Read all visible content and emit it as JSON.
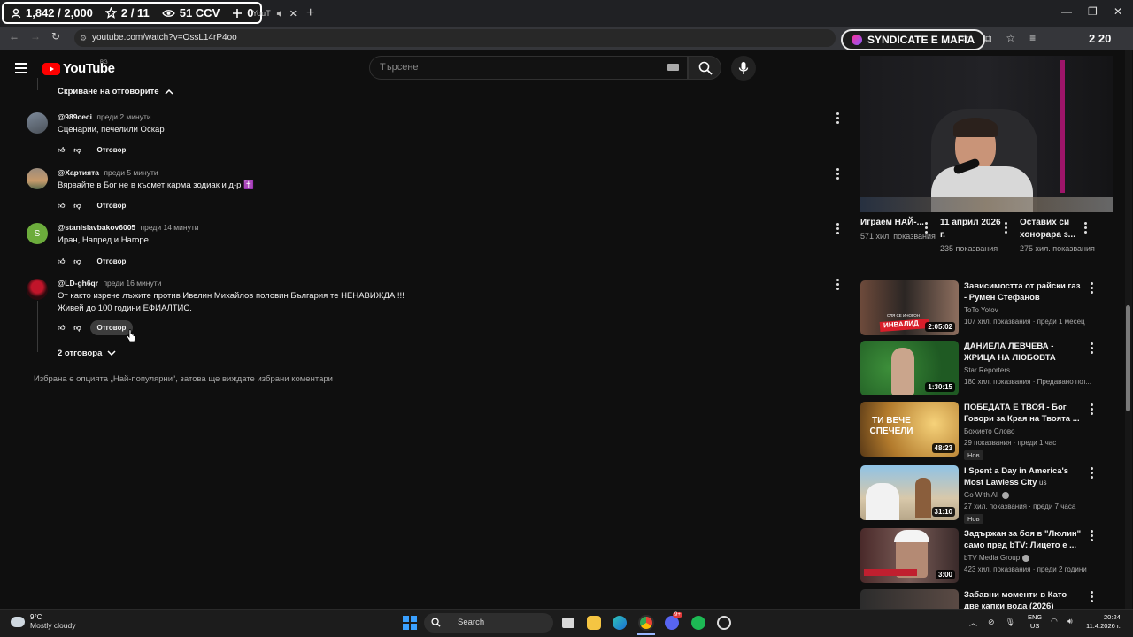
{
  "overlay": {
    "viewers": "1,842 / 2,000",
    "stars": "2 / 11",
    "watch": "51 CCV",
    "plus": "0"
  },
  "browser": {
    "tab_title": "YouT",
    "url": "youtube.com/watch?v=OssL14rP4oo",
    "extension_label": "SYNDICATE E MAFIA",
    "extension_counter": "2 20"
  },
  "youtube": {
    "logo_text": "YouTube",
    "region": "BG",
    "search_placeholder": "Търсене"
  },
  "comments": {
    "hide_replies": "Скриване на отговорите",
    "reply_label": "Отговор",
    "items": [
      {
        "author": "@989ceci",
        "time": "преди 2 минути",
        "text": "Сценарии, печелили Оскар"
      },
      {
        "author": "@Хартията",
        "time": "преди 5 минути",
        "text": "Вярвайте в Бог не в късмет карма зодиак и д-р ✝️"
      },
      {
        "author": "@stanislavbakov6005",
        "time": "преди 14 минути",
        "text": "Иран, Напред и Нагоре."
      },
      {
        "author": "@LD-gh6qr",
        "time": "преди 16 минути",
        "text_line1": "От както изрече лъжите против Ивелин Михайлов половин България те НЕНАВИЖДА !!!",
        "text_line2": "Живей до 100 години ЕФИАЛТИС."
      }
    ],
    "replies_toggle": "2 отговора",
    "sort_note": "Избрана е опцията „Най-популярни“, затова ще виждате избрани коментари",
    "avatar_letter": "S"
  },
  "shorts": [
    {
      "title": "Играем НАЙ-...",
      "views": "571 хил. показвания"
    },
    {
      "title": "11 април 2026 г.",
      "views": "235 показвания"
    },
    {
      "title": "Оставих си хонорара з...",
      "views": "275 хил. показвания"
    }
  ],
  "recommendations": [
    {
      "title": "Зависимостта от райски газ - Румен Стефанов",
      "channel": "ToTo Yotov",
      "meta": "107 хил. показвания · преди 1 месец",
      "duration": "2:05:02",
      "badge": "",
      "thumb_overlay": "ИНВАЛИД",
      "thumb_small_text": "СЛЯ СЕ ИНОГОН",
      "verified": false
    },
    {
      "title": "ДАНИЕЛА ЛЕВЧЕВА - ЖРИЦА НА ЛЮБОВТА",
      "channel": "Star Reporters",
      "meta": "180 хил. показвания · Предавано пот...",
      "duration": "1:30:15",
      "badge": "",
      "thumb_overlay": "",
      "thumb_small_text": "",
      "verified": false
    },
    {
      "title": "ПОБЕДАТА Е ТВОЯ - Бог Говори за Края на Твоята ...",
      "channel": "Божието Слово",
      "meta": "29 показвания · преди 1 час",
      "duration": "48:23",
      "badge": "Нов",
      "thumb_overlay": "ТИ ВЕЧЕ СПЕЧЕЛИ",
      "thumb_small_text": "",
      "verified": false
    },
    {
      "title": "I Spent a Day in America's Most Lawless City",
      "title_suffix": "us",
      "channel": "Go With Ali",
      "meta": "27 хил. показвания · преди 7 часа",
      "duration": "31:10",
      "badge": "Нов",
      "thumb_overlay": "",
      "thumb_small_text": "",
      "verified": true
    },
    {
      "title": "Задържан за боя в \"Люлин\" само пред bTV: Лицето е ...",
      "channel": "bTV Media Group",
      "meta": "423 хил. показвания · преди 2 години",
      "duration": "3:00",
      "badge": "",
      "thumb_overlay": "",
      "thumb_small_text": "",
      "verified": true
    },
    {
      "title": "Забавни моменти в Като две капки вода (2026)",
      "channel": "",
      "meta": "",
      "duration": "",
      "badge": "",
      "thumb_overlay": "",
      "thumb_small_text": "",
      "verified": false
    }
  ],
  "taskbar": {
    "temp": "9°C",
    "weather": "Mostly cloudy",
    "search": "Search",
    "lang_1": "ENG",
    "lang_2": "US",
    "time": "20:24",
    "date": "11.4.2026 г.",
    "discord_badge": "9+"
  },
  "colors": {
    "background": "#0f0f0f",
    "youtube_red": "#ff0000",
    "text_secondary": "#aaaaaa"
  }
}
